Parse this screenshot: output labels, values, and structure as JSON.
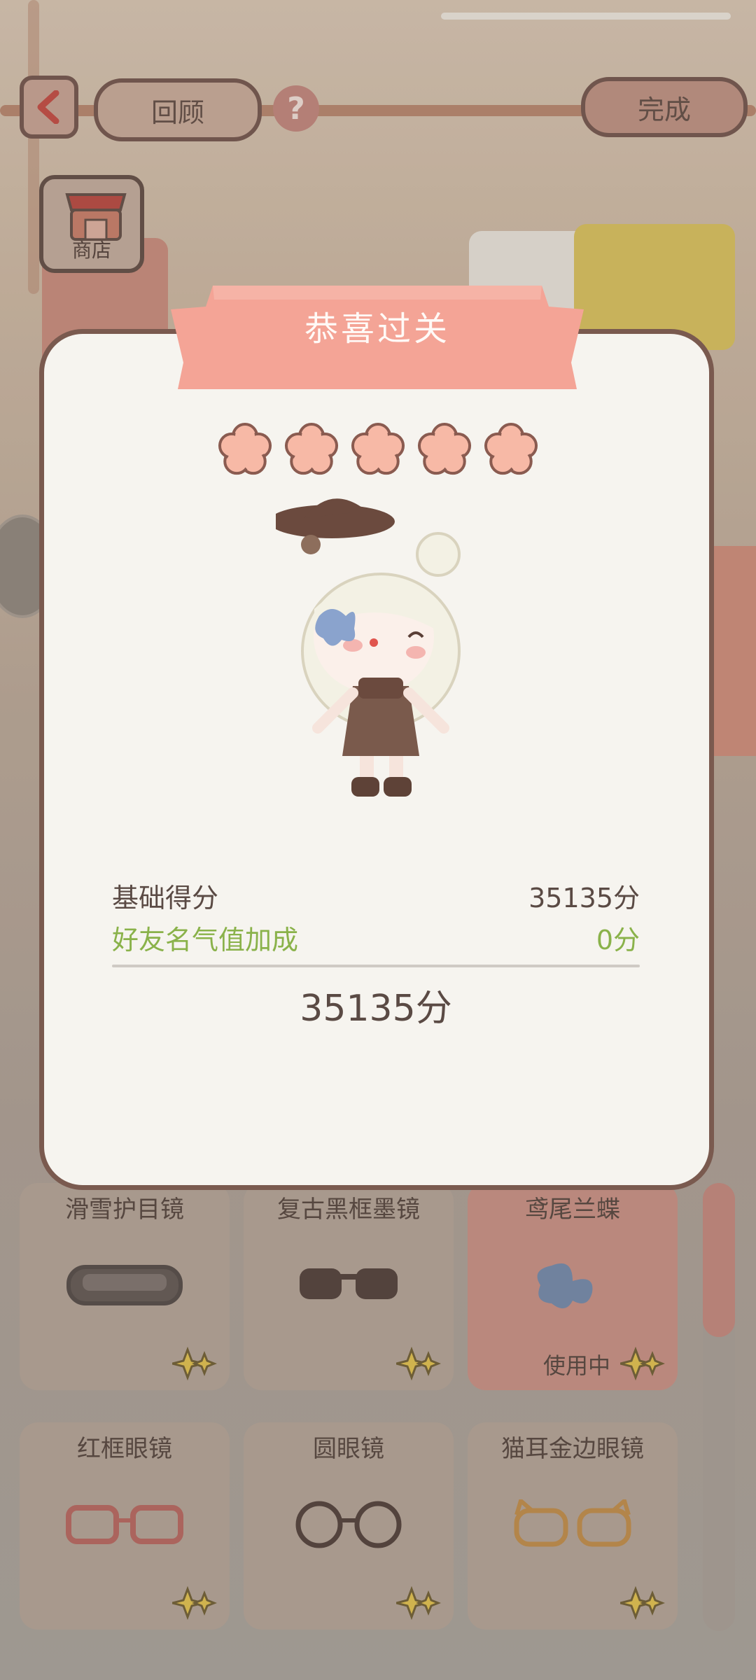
{
  "header": {
    "review_label": "回顾",
    "done_label": "完成",
    "help_glyph": "?",
    "shop_label": "商店"
  },
  "result": {
    "title": "恭喜过关",
    "stars_earned": 5,
    "stars_total": 5,
    "base_score_label": "基础得分",
    "base_score_value": "35135分",
    "bonus_label": "好友名气值加成",
    "bonus_value": "0分",
    "total": "35135分"
  },
  "items": [
    {
      "name": "滑雪护目镜",
      "icon": "ski-goggles-icon",
      "status": ""
    },
    {
      "name": "复古黑框墨镜",
      "icon": "black-sunglasses-icon",
      "status": ""
    },
    {
      "name": "鸢尾兰蝶",
      "icon": "blue-butterfly-icon",
      "status": "使用中"
    },
    {
      "name": "红框眼镜",
      "icon": "red-glasses-icon",
      "status": ""
    },
    {
      "name": "圆眼镜",
      "icon": "round-glasses-icon",
      "status": ""
    },
    {
      "name": "猫耳金边眼镜",
      "icon": "cat-ear-glasses-icon",
      "status": ""
    }
  ],
  "colors": {
    "banner": "#f4a496",
    "star": "#f7b9a6",
    "bonus_text": "#8ab24a",
    "modal_border": "#7a5a4f",
    "active_card": "#c98e83"
  }
}
